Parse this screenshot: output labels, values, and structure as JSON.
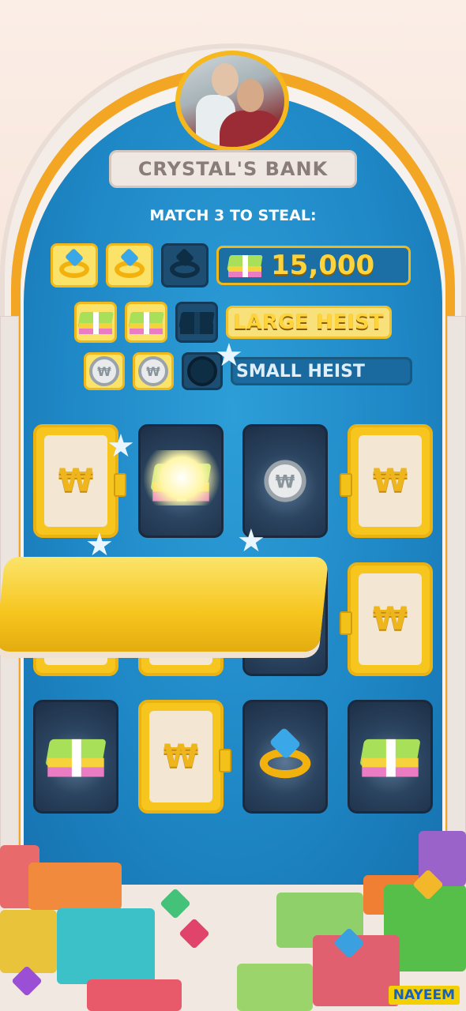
{
  "bank": {
    "title": "CRYSTAL'S BANK"
  },
  "instructions": "MATCH 3 TO STEAL:",
  "prizes": [
    {
      "tier": "jackpot",
      "item": "ring-icon",
      "collected": 2,
      "needed": 3,
      "label": "15,000"
    },
    {
      "tier": "large",
      "item": "cash-icon",
      "collected": 2,
      "needed": 3,
      "label": "LARGE HEIST"
    },
    {
      "tier": "small",
      "item": "coin-icon",
      "collected": 2,
      "needed": 3,
      "label": "SMALL HEIST"
    }
  ],
  "board": {
    "closed_card_symbol": "₩",
    "cards": [
      {
        "row": 1,
        "col": 1,
        "state": "closed"
      },
      {
        "row": 1,
        "col": 2,
        "state": "revealed",
        "item": "cash-icon",
        "highlight": true
      },
      {
        "row": 1,
        "col": 3,
        "state": "revealed",
        "item": "coin-icon"
      },
      {
        "row": 1,
        "col": 4,
        "state": "closed"
      },
      {
        "row": 2,
        "col": 1,
        "state": "flipping"
      },
      {
        "row": 2,
        "col": 2,
        "state": "flipping"
      },
      {
        "row": 2,
        "col": 3,
        "state": "revealed",
        "item": "coin-icon"
      },
      {
        "row": 2,
        "col": 4,
        "state": "closed"
      },
      {
        "row": 3,
        "col": 1,
        "state": "revealed",
        "item": "cash-icon"
      },
      {
        "row": 3,
        "col": 2,
        "state": "closed"
      },
      {
        "row": 3,
        "col": 3,
        "state": "revealed",
        "item": "ring-icon"
      },
      {
        "row": 3,
        "col": 4,
        "state": "revealed",
        "item": "cash-icon"
      }
    ]
  },
  "watermark": "NAYEEM"
}
